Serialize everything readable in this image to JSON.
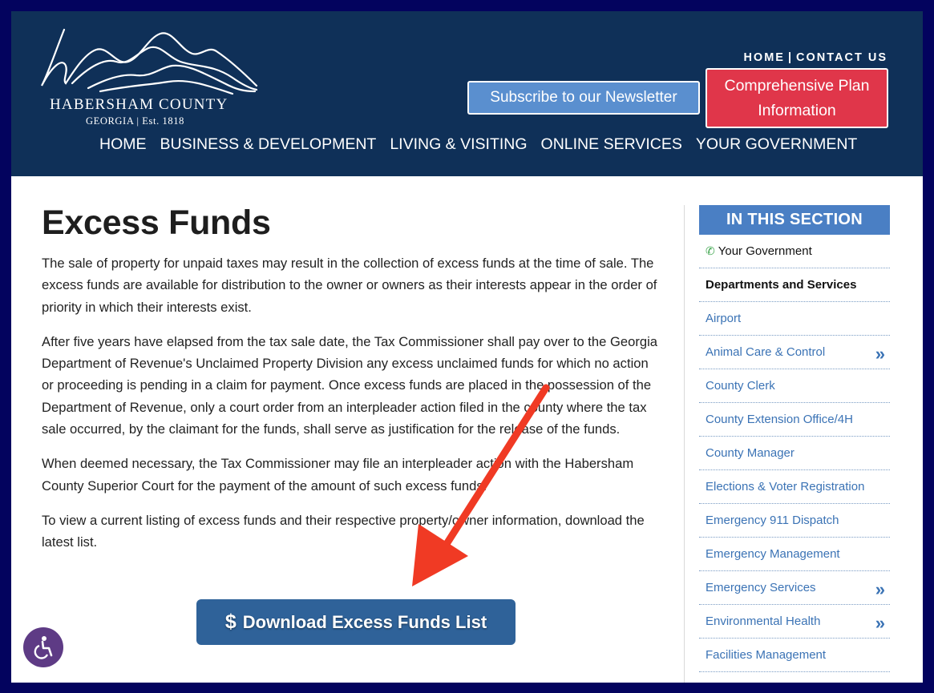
{
  "header": {
    "logo": {
      "name": "HABERSHAM COUNTY",
      "sub": "GEORGIA | Est. 1818"
    },
    "util_links": [
      "HOME",
      "CONTACT US"
    ],
    "util_sep": "|",
    "newsletter_button": "Subscribe to our Newsletter",
    "plan_button": [
      "Comprehensive Plan",
      "Information"
    ],
    "nav": [
      "HOME",
      "BUSINESS & DEVELOPMENT",
      "LIVING & VISITING",
      "ONLINE SERVICES",
      "YOUR GOVERNMENT"
    ]
  },
  "main": {
    "title": "Excess Funds",
    "paragraphs": [
      "The sale of property for unpaid taxes may result in the collection of excess funds at the time of sale. The excess funds are available for distribution to the owner or owners as their interests appear in the order of priority in which their interests exist.",
      "After five years have elapsed from the tax sale date, the Tax Commissioner shall pay over to the Georgia Department of Revenue's Unclaimed Property Division any excess unclaimed funds for which no action or proceeding is pending in a claim for payment.  Once excess funds are placed in the possession of the Department of Revenue, only a court order from an interpleader action filed in the county where the tax sale occurred, by the claimant for the funds, shall serve as justification for the release of the funds.",
      "When deemed necessary, the Tax Commissioner may file an interpleader action with the Habersham County Superior Court for the payment of the amount of such excess funds.",
      "To view a current listing of excess funds and their respective property/owner information, download the latest list."
    ],
    "download_button": {
      "icon": "$",
      "label": "Download Excess Funds List"
    }
  },
  "sidebar": {
    "heading": "IN THIS SECTION",
    "parent": "Your Government",
    "current": "Departments and Services",
    "items": [
      {
        "label": "Airport",
        "has_children": false
      },
      {
        "label": "Animal Care & Control",
        "has_children": true
      },
      {
        "label": "County Clerk",
        "has_children": false
      },
      {
        "label": "County Extension Office/4H",
        "has_children": false
      },
      {
        "label": "County Manager",
        "has_children": false
      },
      {
        "label": "Elections & Voter Registration",
        "has_children": false
      },
      {
        "label": "Emergency 911 Dispatch",
        "has_children": false
      },
      {
        "label": "Emergency Management",
        "has_children": false
      },
      {
        "label": "Emergency Services",
        "has_children": true
      },
      {
        "label": "Environmental Health",
        "has_children": true
      },
      {
        "label": "Facilities Management",
        "has_children": false
      }
    ],
    "expand_glyph": "»"
  },
  "icons": {
    "phone": "phone-icon",
    "accessibility": "accessibility-icon",
    "dollar": "dollar-icon",
    "annotation": "red-arrow-annotation"
  },
  "colors": {
    "header_bg": "#0f3058",
    "newsletter_bg": "#5a8fcf",
    "plan_bg": "#e0364a",
    "download_bg": "#2f6299",
    "sidebar_head_bg": "#4a7fc4",
    "link": "#3b73b5",
    "arrow": "#f03a24",
    "outer_frame": "#03035e"
  }
}
